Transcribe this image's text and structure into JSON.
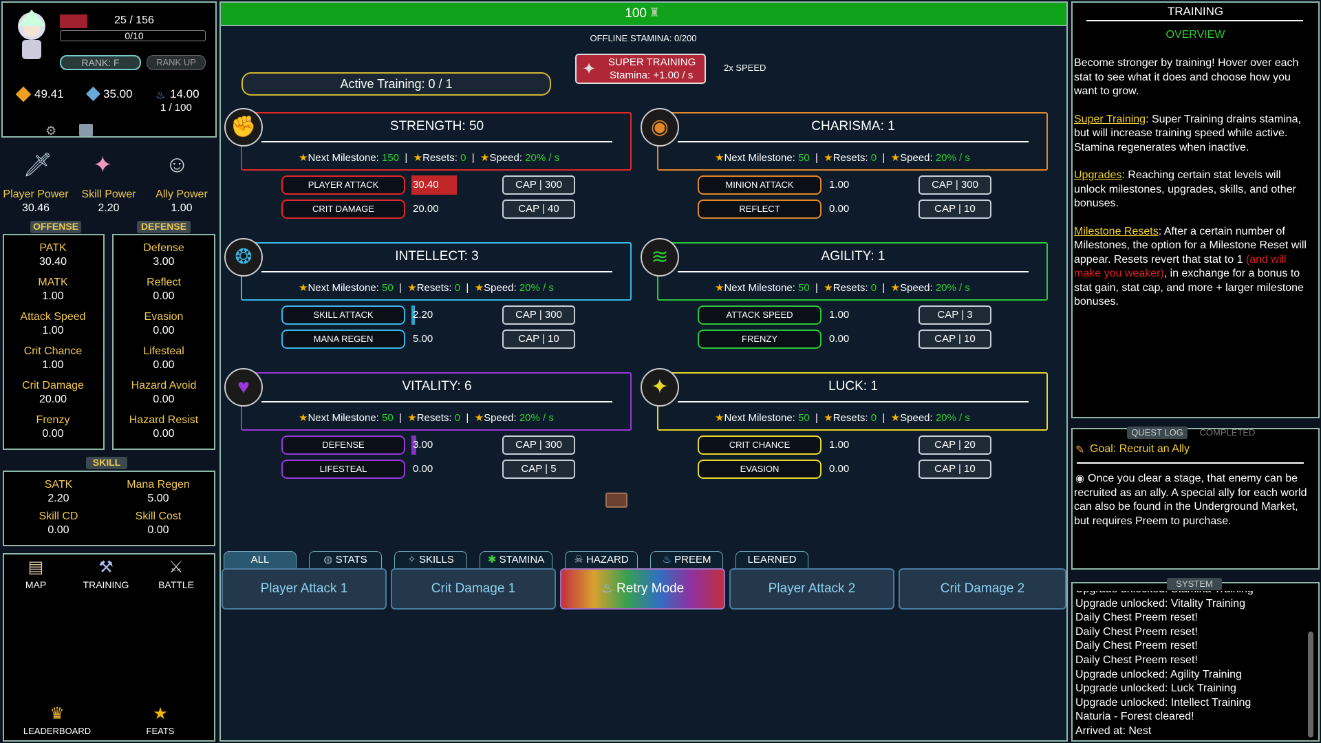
{
  "player": {
    "hp_text": "25 / 156",
    "mana_text": "0/10",
    "rank": "RANK: F",
    "rank_up": "RANK UP",
    "gold": "49.41",
    "gems": "35.00",
    "preem": "14.00",
    "preem_sub": "1 / 100"
  },
  "powers": [
    {
      "label": "Player Power",
      "value": "30.46"
    },
    {
      "label": "Skill Power",
      "value": "2.20"
    },
    {
      "label": "Ally Power",
      "value": "1.00"
    }
  ],
  "offense": {
    "header": "OFFENSE",
    "stats": [
      {
        "label": "PATK",
        "value": "30.40"
      },
      {
        "label": "MATK",
        "value": "1.00"
      },
      {
        "label": "Attack Speed",
        "value": "1.00"
      },
      {
        "label": "Crit Chance",
        "value": "1.00"
      },
      {
        "label": "Crit Damage",
        "value": "20.00"
      },
      {
        "label": "Frenzy",
        "value": "0.00"
      }
    ]
  },
  "defense": {
    "header": "DEFENSE",
    "stats": [
      {
        "label": "Defense",
        "value": "3.00"
      },
      {
        "label": "Reflect",
        "value": "0.00"
      },
      {
        "label": "Evasion",
        "value": "0.00"
      },
      {
        "label": "Lifesteal",
        "value": "0.00"
      },
      {
        "label": "Hazard Avoid",
        "value": "0.00"
      },
      {
        "label": "Hazard Resist",
        "value": "0.00"
      }
    ]
  },
  "skill": {
    "header": "SKILL",
    "stats": [
      {
        "label": "SATK",
        "value": "2.20"
      },
      {
        "label": "Mana Regen",
        "value": "5.00"
      },
      {
        "label": "Skill CD",
        "value": "0.00"
      },
      {
        "label": "Skill Cost",
        "value": "0.00"
      }
    ]
  },
  "nav": [
    {
      "label": "MAP",
      "icon": "map-icon"
    },
    {
      "label": "TRAINING",
      "icon": "training-icon"
    },
    {
      "label": "BATTLE",
      "icon": "battle-icon"
    },
    {
      "label": "LEADERBOARD",
      "icon": "trophy-icon"
    },
    {
      "label": "FEATS",
      "icon": "star-icon"
    }
  ],
  "top": {
    "stamina": "100",
    "offline": "OFFLINE STAMINA: 0/200",
    "active": "Active Training: 0 / 1",
    "super_title": "SUPER TRAINING",
    "super_sub": "Stamina: +1.00 / s",
    "speed": "2x SPEED"
  },
  "milestone_labels": {
    "next": "Next Milestone:",
    "resets": "Resets:",
    "speed": "Speed:"
  },
  "cards": [
    {
      "title": "STRENGTH: 50",
      "color": "#e02828",
      "milestone": "150",
      "resets": "0",
      "speed": "20% / s",
      "rows": [
        {
          "label": "PLAYER ATTACK",
          "value": "30.40",
          "fill": 0.1,
          "cap": "CAP | 300"
        },
        {
          "label": "CRIT DAMAGE",
          "value": "20.00",
          "fill": 0,
          "cap": "CAP | 40"
        }
      ]
    },
    {
      "title": "CHARISMA: 1",
      "color": "#e08828",
      "milestone": "50",
      "resets": "0",
      "speed": "20% / s",
      "rows": [
        {
          "label": "MINION ATTACK",
          "value": "1.00",
          "fill": 0,
          "cap": "CAP | 300"
        },
        {
          "label": "REFLECT",
          "value": "0.00",
          "fill": 0,
          "cap": "CAP | 10"
        }
      ]
    },
    {
      "title": "INTELLECT: 3",
      "color": "#38b8e8",
      "milestone": "50",
      "resets": "0",
      "speed": "20% / s",
      "rows": [
        {
          "label": "SKILL ATTACK",
          "value": "2.20",
          "fill": 0.0073,
          "cap": "CAP | 300"
        },
        {
          "label": "MANA REGEN",
          "value": "5.00",
          "fill": 0,
          "cap": "CAP | 10"
        }
      ]
    },
    {
      "title": "AGILITY: 1",
      "color": "#28c838",
      "milestone": "50",
      "resets": "0",
      "speed": "20% / s",
      "rows": [
        {
          "label": "ATTACK SPEED",
          "value": "1.00",
          "fill": 0,
          "cap": "CAP | 3"
        },
        {
          "label": "FRENZY",
          "value": "0.00",
          "fill": 0,
          "cap": "CAP | 10"
        }
      ]
    },
    {
      "title": "VITALITY: 6",
      "color": "#9838d8",
      "milestone": "50",
      "resets": "0",
      "speed": "20% / s",
      "rows": [
        {
          "label": "DEFENSE",
          "value": "3.00",
          "fill": 0.01,
          "cap": "CAP | 300"
        },
        {
          "label": "LIFESTEAL",
          "value": "0.00",
          "fill": 0,
          "cap": "CAP | 5"
        }
      ]
    },
    {
      "title": "LUCK: 1",
      "color": "#e8d828",
      "milestone": "50",
      "resets": "0",
      "speed": "20% / s",
      "rows": [
        {
          "label": "CRIT CHANCE",
          "value": "1.00",
          "fill": 0,
          "cap": "CAP | 20"
        },
        {
          "label": "EVASION",
          "value": "0.00",
          "fill": 0,
          "cap": "CAP | 10"
        }
      ]
    }
  ],
  "tabs": [
    {
      "label": "ALL"
    },
    {
      "label": "STATS"
    },
    {
      "label": "SKILLS"
    },
    {
      "label": "STAMINA"
    },
    {
      "label": "HAZARD"
    },
    {
      "label": "PREEM"
    },
    {
      "label": "LEARNED"
    }
  ],
  "quick": [
    "Player Attack 1",
    "Crit Damage 1",
    "Retry Mode",
    "Player Attack 2",
    "Crit Damage 2"
  ],
  "right": {
    "title": "TRAINING",
    "subtitle": "OVERVIEW",
    "intro": "Become stronger by training! Hover over each stat to see what it does and choose how you want to grow.",
    "super_link": "Super Training",
    "super_text": ": Super Training drains stamina, but will increase training speed while active. Stamina regenerates when inactive.",
    "upg_link": "Upgrades",
    "upg_text": ": Reaching certain stat levels will unlock milestones, upgrades, skills, and other bonuses.",
    "mr_link": "Milestone Resets",
    "mr_text1": ": After a certain number of Milestones, the option for a Milestone Reset will appear. Resets revert that stat to 1 ",
    "mr_red": "(and will make you weaker)",
    "mr_text2": ", in exchange for a bonus to stat gain, stat cap, and more + larger milestone bonuses."
  },
  "quest": {
    "tab1": "QUEST LOG",
    "tab2": "COMPLETED",
    "goal": "Goal: Recruit an Ally",
    "text": "Once you clear a stage, that enemy can be recruited as an ally. A special ally for each world can also be found in the Underground Market, but requires Preem to purchase."
  },
  "system": {
    "header": "SYSTEM",
    "lines": [
      "Upgrade unlocked: Stamina Training",
      "Upgrade unlocked: Vitality Training",
      "Daily Chest Preem reset!",
      "Daily Chest Preem reset!",
      "Daily Chest Preem reset!",
      "Daily Chest Preem reset!",
      "Upgrade unlocked: Agility Training",
      "Upgrade unlocked: Luck Training",
      "Upgrade unlocked: Intellect Training",
      "Naturia - Forest cleared!",
      "Arrived at: Nest"
    ]
  }
}
